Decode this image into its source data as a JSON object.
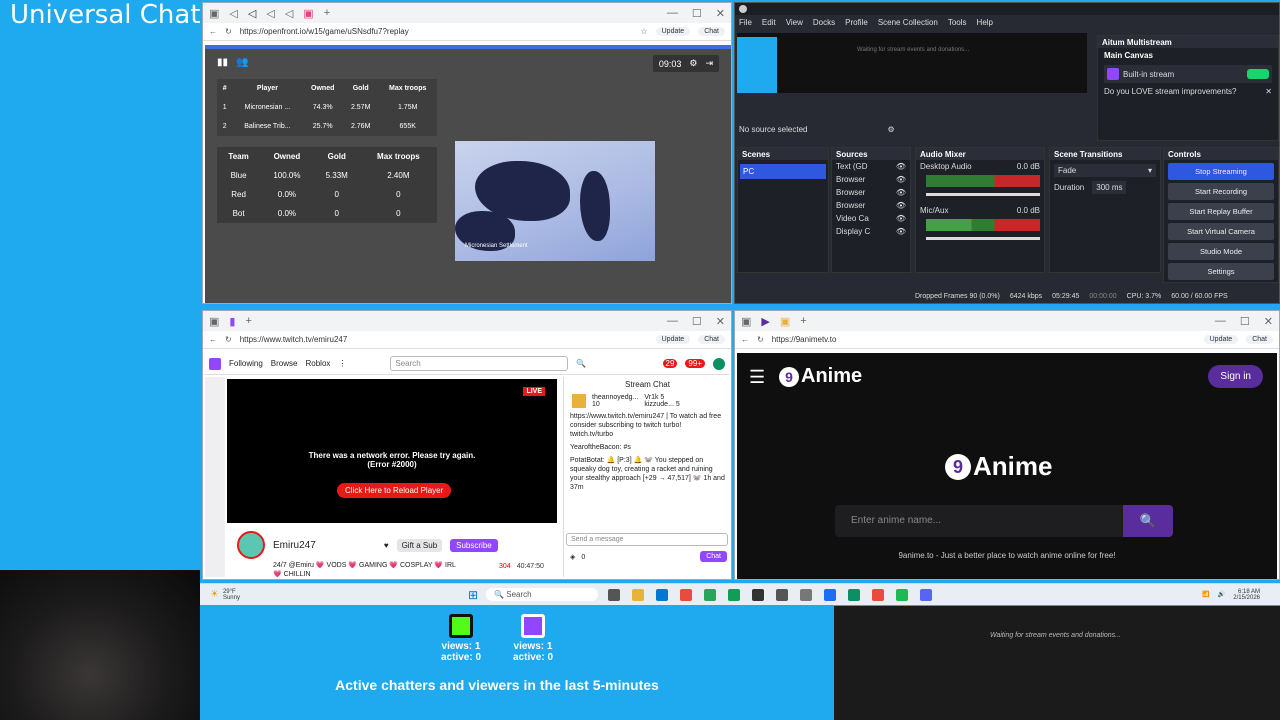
{
  "overlay": {
    "title": "Universal Chat"
  },
  "openfront": {
    "url": "https://openfront.io/w15/game/uSNsdfu7?replay",
    "update": "Update",
    "chat": "Chat",
    "timer": "09:03",
    "players_headers": [
      "#",
      "Player",
      "Owned",
      "Gold",
      "Max troops"
    ],
    "players": [
      [
        "1",
        "Micronesian ...",
        "74.3%",
        "2.57M",
        "1.75M"
      ],
      [
        "2",
        "Balinese Trib...",
        "25.7%",
        "2.76M",
        "655K"
      ]
    ],
    "team_headers": [
      "Team",
      "Owned",
      "Gold",
      "Max troops"
    ],
    "teams": [
      [
        "Blue",
        "100.0%",
        "5.33M",
        "2.40M"
      ],
      [
        "Red",
        "0.0%",
        "0",
        "0"
      ],
      [
        "Bot",
        "0.0%",
        "0",
        "0"
      ]
    ],
    "map_label": "Micronesian Settlement"
  },
  "obs": {
    "menu": [
      "File",
      "Edit",
      "View",
      "Docks",
      "Profile",
      "Scene Collection",
      "Tools",
      "Help"
    ],
    "preview_text": "Waiting for stream events and donations...",
    "no_source": "No source selected",
    "aitum": {
      "title": "Aitum Multistream",
      "canvas": "Main Canvas",
      "built_in": "Built-in stream",
      "love": "Do you LOVE stream improvements?"
    },
    "scenes": {
      "title": "Scenes",
      "items": [
        "PC"
      ]
    },
    "sources": {
      "title": "Sources",
      "items": [
        "Text (GD",
        "Browser",
        "Browser",
        "Browser",
        "Video Ca",
        "Display C"
      ]
    },
    "mixer": {
      "title": "Audio Mixer",
      "ch1": "Desktop Audio",
      "ch1_db": "0.0 dB",
      "ch2": "Mic/Aux",
      "ch2_db": "0.0 dB"
    },
    "transitions": {
      "title": "Scene Transitions",
      "value": "Fade",
      "duration_label": "Duration",
      "duration": "300 ms"
    },
    "controls": {
      "title": "Controls",
      "buttons": [
        "Stop Streaming",
        "Start Recording",
        "Start Replay Buffer",
        "Start Virtual Camera",
        "Studio Mode",
        "Settings"
      ]
    },
    "status": {
      "dropped": "Dropped Frames 90 (0.0%)",
      "kbps": "6424 kbps",
      "live_time": "05:29:45",
      "rec_time": "00:00:00",
      "cpu": "CPU: 3.7%",
      "fps": "60.00 / 60.00 FPS"
    }
  },
  "twitch": {
    "url": "https://www.twitch.tv/emiru247",
    "nav": [
      "Following",
      "Browse",
      "Roblox"
    ],
    "search": "Search",
    "badge1": "29",
    "badge2": "99+",
    "live": "LIVE",
    "error1": "There was a network error. Please try again.",
    "error2": "(Error #2000)",
    "reload": "Click Here to Reload Player",
    "channel": "Emiru247",
    "gift": "Gift a Sub",
    "subscribe": "Subscribe",
    "title_text": "24/7 @Emiru 💗 VODS 💗 GAMING 💗 COSPLAY 💗 IRL 💗 CHILLIN",
    "viewers": "304",
    "uptime": "40:47:50",
    "chat_title": "Stream Chat",
    "gifter1": "theannoyedg...",
    "gifter1_count": "10",
    "gifter2": "Vr1k",
    "gifter2_count": "5",
    "gifter3": "kizzude...",
    "gifter3_count": "5",
    "chat_lines": [
      "https://www.twitch.tv/emiru247 | To watch ad free consider subscribing to twitch turbo! twitch.tv/turbo",
      "YearoftheBacon: #s",
      "PotatBotat: 🔔 [P:3] 🔔 🐭 You stepped on squeaky dog toy, creating a racket and ruining your stealthy approach [+29 → 47,517] 🐭 1h and 37m"
    ],
    "send": "Send a message",
    "points": "0",
    "chat_btn": "Chat"
  },
  "anime": {
    "url": "https://9animetv.to",
    "logo": "Anime",
    "signin": "Sign in",
    "placeholder": "Enter anime name...",
    "tagline": "9anime.to - Just a better place to watch anime online for free!"
  },
  "taskbar": {
    "weather_temp": "29°F",
    "weather_desc": "Sunny",
    "search": "Search",
    "time": "6:18 AM",
    "date": "2/15/2026"
  },
  "chatstats": {
    "kick": {
      "views": "views: 1",
      "active": "active: 0"
    },
    "twitch": {
      "views": "views: 1",
      "active": "active: 0"
    },
    "caption": "Active chatters and viewers in the last 5-minutes"
  },
  "donations": {
    "text": "Waiting for stream events and donations..."
  },
  "colors": {
    "bg": "#1fa9ee",
    "twitch": "#9146ff",
    "anime": "#5a2d9c",
    "kick": "#53fc18"
  }
}
